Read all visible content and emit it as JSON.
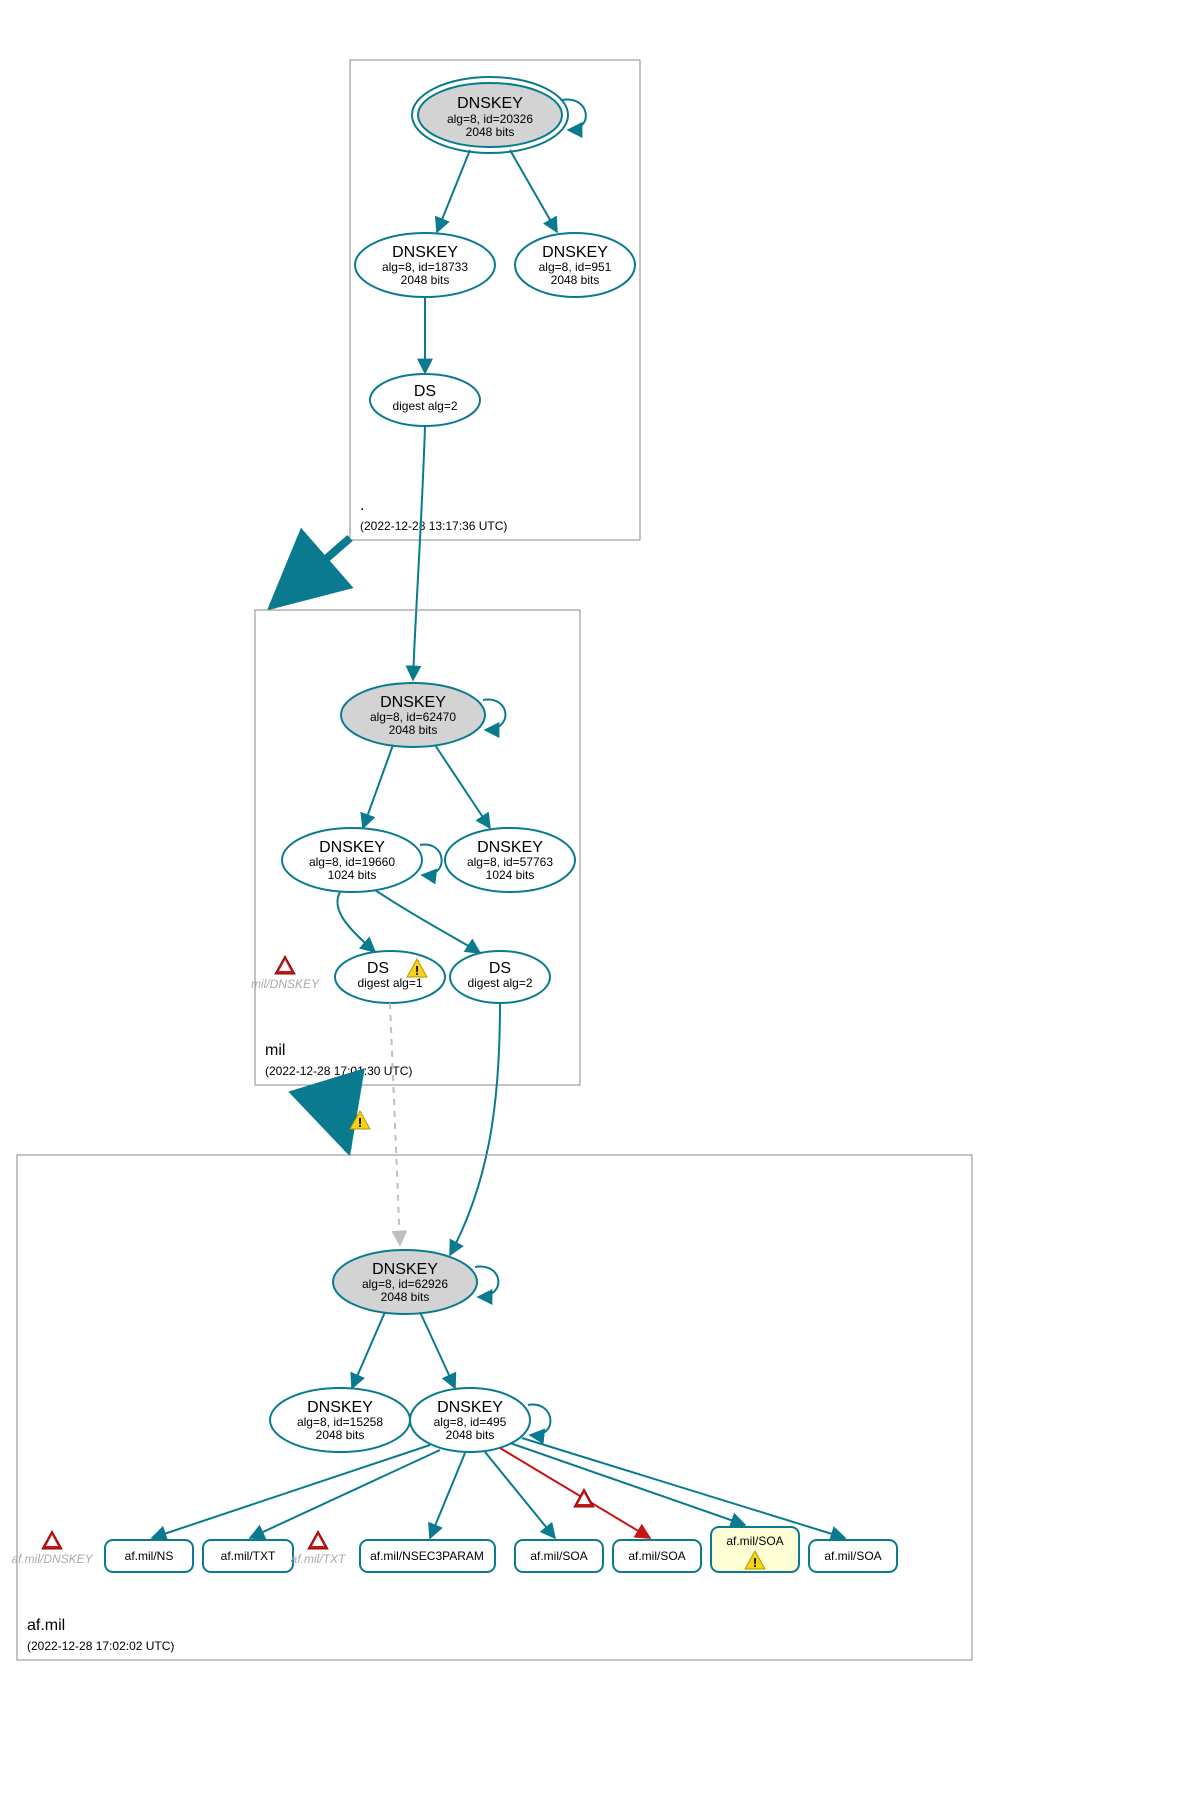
{
  "zones": {
    "root": {
      "label": ".",
      "timestamp": "(2022-12-28 13:17:36 UTC)"
    },
    "mil": {
      "label": "mil",
      "timestamp": "(2022-12-28 17:01:30 UTC)"
    },
    "afmil": {
      "label": "af.mil",
      "timestamp": "(2022-12-28 17:02:02 UTC)"
    }
  },
  "nodes": {
    "root_ksk": {
      "title": "DNSKEY",
      "l1": "alg=8, id=20326",
      "l2": "2048 bits"
    },
    "root_zsk1": {
      "title": "DNSKEY",
      "l1": "alg=8, id=18733",
      "l2": "2048 bits"
    },
    "root_zsk2": {
      "title": "DNSKEY",
      "l1": "alg=8, id=951",
      "l2": "2048 bits"
    },
    "root_ds": {
      "title": "DS",
      "l1": "digest alg=2"
    },
    "mil_ksk": {
      "title": "DNSKEY",
      "l1": "alg=8, id=62470",
      "l2": "2048 bits"
    },
    "mil_zsk1": {
      "title": "DNSKEY",
      "l1": "alg=8, id=19660",
      "l2": "1024 bits"
    },
    "mil_zsk2": {
      "title": "DNSKEY",
      "l1": "alg=8, id=57763",
      "l2": "1024 bits"
    },
    "mil_ds1": {
      "title": "DS",
      "l1": "digest alg=1"
    },
    "mil_ds2": {
      "title": "DS",
      "l1": "digest alg=2"
    },
    "af_ksk": {
      "title": "DNSKEY",
      "l1": "alg=8, id=62926",
      "l2": "2048 bits"
    },
    "af_zsk1": {
      "title": "DNSKEY",
      "l1": "alg=8, id=15258",
      "l2": "2048 bits"
    },
    "af_zsk2": {
      "title": "DNSKEY",
      "l1": "alg=8, id=495",
      "l2": "2048 bits"
    }
  },
  "rr": {
    "ns": "af.mil/NS",
    "txt1": "af.mil/TXT",
    "nsec3": "af.mil/NSEC3PARAM",
    "soa1": "af.mil/SOA",
    "soa2": "af.mil/SOA",
    "soa3": "af.mil/SOA",
    "soa4": "af.mil/SOA"
  },
  "greyed": {
    "mil_dnskey": "mil/DNSKEY",
    "af_dnskey": "af.mil/DNSKEY",
    "af_txt": "af.mil/TXT"
  }
}
